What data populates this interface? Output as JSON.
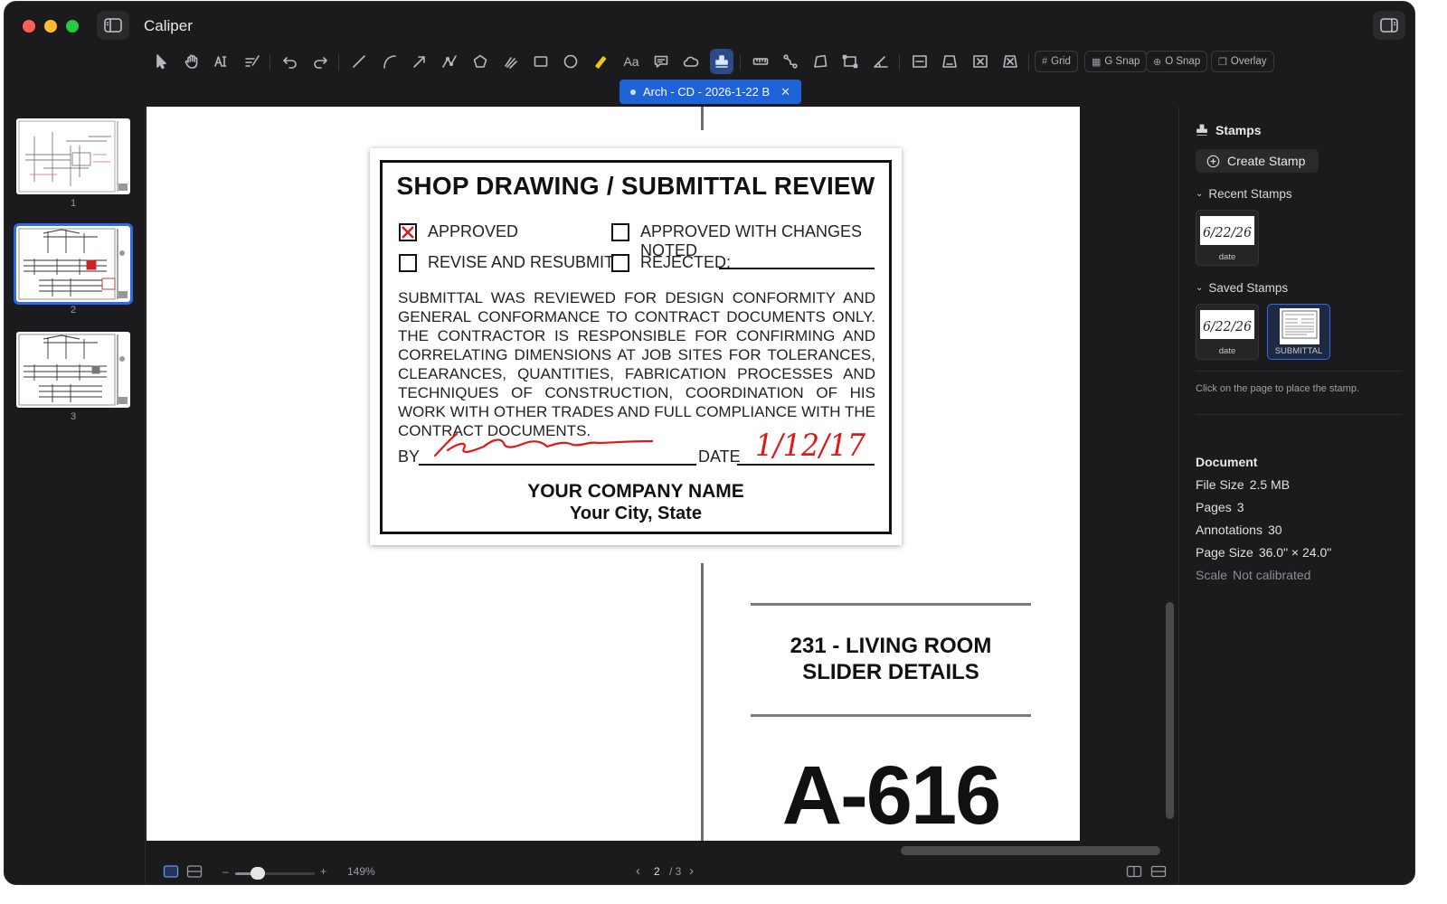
{
  "app": {
    "title": "Caliper"
  },
  "toolbar": {
    "text_tool": "Aa",
    "pills": [
      "Grid",
      "G Snap",
      "O Snap",
      "Overlay"
    ]
  },
  "tab": {
    "label": "Arch - CD - 2026-1-22 B"
  },
  "thumbnails": [
    {
      "num": "1"
    },
    {
      "num": "2"
    },
    {
      "num": "3"
    }
  ],
  "page": {
    "stamp": {
      "heading": "SHOP DRAWING / SUBMITTAL REVIEW",
      "options": {
        "approved": "APPROVED",
        "approved_changes": "APPROVED WITH CHANGES NOTED",
        "revise": "REVISE AND RESUBMIT",
        "rejected": "REJECTED:"
      },
      "checked": "approved",
      "body": "SUBMITTAL WAS REVIEWED FOR DESIGN CONFORMITY AND GENERAL CONFORMANCE TO CONTRACT DOCUMENTS ONLY. THE CONTRACTOR IS RESPONSIBLE FOR CONFIRMING AND CORRELATING DIMENSIONS AT JOB SITES FOR TOLERANCES, CLEARANCES, QUANTITIES, FABRICATION PROCESSES AND TECHNIQUES OF CONSTRUCTION, COORDINATION OF HIS WORK WITH OTHER TRADES AND FULL COMPLIANCE WITH THE CONTRACT DOCUMENTS.",
      "by_label": "BY",
      "date_label": "DATE",
      "handwritten_date": "1/12/17",
      "company": "YOUR COMPANY NAME",
      "city": "Your City, State"
    },
    "room_title_line1": "231 - LIVING ROOM",
    "room_title_line2": "SLIDER DETAILS",
    "sheet_number": "A-616"
  },
  "bottombar": {
    "zoom_minus": "–",
    "zoom_plus": "+",
    "zoom_level": "149%",
    "zoom_fraction": 0.28,
    "prev": "‹",
    "current_page": "2",
    "total_pages": "/ 3",
    "next": "›"
  },
  "inspector": {
    "stamps_title": "Stamps",
    "create_stamp": "Create Stamp",
    "recent_title": "Recent Stamps",
    "recent": [
      {
        "label": "date",
        "preview": "6/22/26"
      }
    ],
    "saved_title": "Saved Stamps",
    "saved": [
      {
        "label": "date",
        "preview": "6/22/26"
      },
      {
        "label": "SUBMITTAL"
      }
    ],
    "hint": "Click on the page to place the stamp.",
    "document_title": "Document",
    "file_size_label": "File Size",
    "file_size": "2.5 MB",
    "pages_label": "Pages",
    "pages": "3",
    "annotations_label": "Annotations",
    "annotations": "30",
    "page_size_label": "Page Size",
    "page_size": "36.0\" × 24.0\"",
    "scale_label": "Scale",
    "scale": "Not calibrated"
  },
  "colors": {
    "accent": "#2f6be6",
    "tab": "#1f63d8",
    "signature": "#e01818",
    "checkmark": "#e01818"
  }
}
